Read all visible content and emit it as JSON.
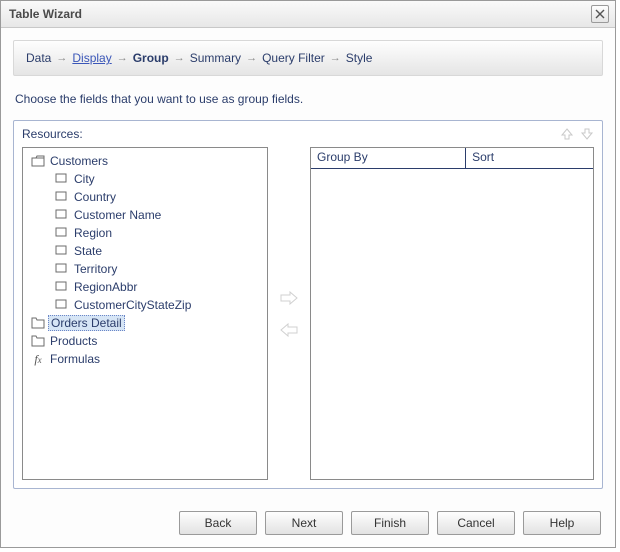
{
  "window": {
    "title": "Table Wizard"
  },
  "breadcrumb": {
    "steps": {
      "data": "Data",
      "display": "Display",
      "group": "Group",
      "summary": "Summary",
      "queryfilter": "Query Filter",
      "style": "Style"
    }
  },
  "instruction": "Choose the fields that you want to use as group fields.",
  "resources": {
    "label": "Resources:"
  },
  "tree": {
    "customers": {
      "label": "Customers",
      "children": {
        "city": "City",
        "country": "Country",
        "customerName": "Customer Name",
        "region": "Region",
        "state": "State",
        "territory": "Territory",
        "regionAbbr": "RegionAbbr",
        "customerCityStateZip": "CustomerCityStateZip"
      }
    },
    "ordersDetail": {
      "label": "Orders Detail"
    },
    "products": {
      "label": "Products"
    },
    "formulas": {
      "label": "Formulas"
    }
  },
  "grid": {
    "columns": {
      "groupBy": "Group By",
      "sort": "Sort"
    }
  },
  "buttons": {
    "back": "Back",
    "next": "Next",
    "finish": "Finish",
    "cancel": "Cancel",
    "help": "Help"
  },
  "icons": {
    "close": "close-icon",
    "arrowUp": "arrow-up-icon",
    "arrowDown": "arrow-down-icon",
    "arrowRight": "arrow-right-icon",
    "arrowLeft": "arrow-left-icon",
    "folder": "folder-icon",
    "field": "field-icon",
    "formula": "formula-icon"
  }
}
